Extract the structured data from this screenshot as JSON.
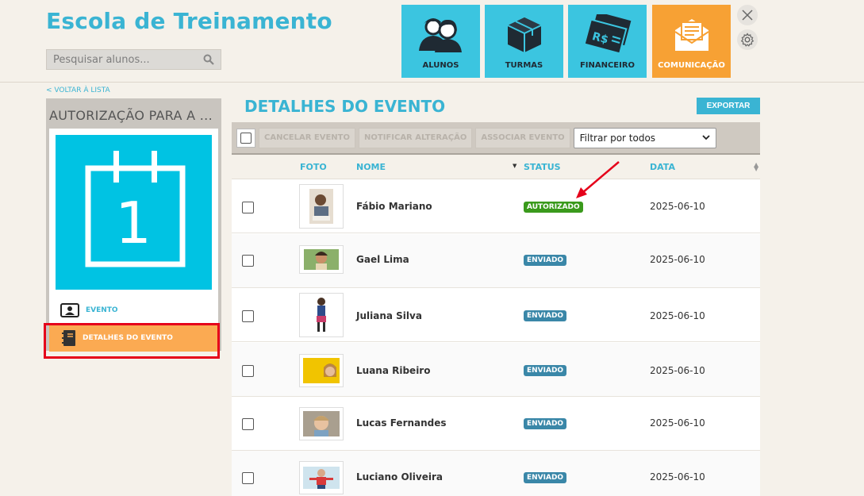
{
  "app": {
    "title": "Escola de Treinamento",
    "search_placeholder": "Pesquisar alunos..."
  },
  "nav": [
    {
      "label": "ALUNOS",
      "icon": "students-icon",
      "active": false
    },
    {
      "label": "TURMAS",
      "icon": "box-icon",
      "active": false
    },
    {
      "label": "FINANCEIRO",
      "icon": "money-icon",
      "active": false
    },
    {
      "label": "COMUNICAÇÃO",
      "icon": "envelope-icon",
      "active": true
    }
  ],
  "sidebar": {
    "back_link": "< VOLTAR À LISTA",
    "title": "AUTORIZAÇÃO PARA A ...",
    "calendar_day": "1",
    "items": [
      {
        "label": "EVENTO",
        "icon": "contact-card-icon"
      },
      {
        "label": "DETALHES DO EVENTO",
        "icon": "notebook-icon"
      }
    ]
  },
  "main": {
    "title": "DETALHES DO EVENTO",
    "export_label": "EXPORTAR",
    "toolbar": {
      "cancel": "CANCELAR EVENTO",
      "notify": "NOTIFICAR ALTERAÇÃO",
      "associate": "ASSOCIAR EVENTO",
      "filter": "Filtrar por todos"
    },
    "columns": {
      "photo": "FOTO",
      "name": "NOME",
      "status": "STATUS",
      "date": "DATA"
    },
    "rows": [
      {
        "name": "Fábio Mariano",
        "status": "AUTORIZADO",
        "date": "2025-06-10"
      },
      {
        "name": "Gael Lima",
        "status": "ENVIADO",
        "date": "2025-06-10"
      },
      {
        "name": "Juliana Silva",
        "status": "ENVIADO",
        "date": "2025-06-10"
      },
      {
        "name": "Luana Ribeiro",
        "status": "ENVIADO",
        "date": "2025-06-10"
      },
      {
        "name": "Lucas Fernandes",
        "status": "ENVIADO",
        "date": "2025-06-10"
      },
      {
        "name": "Luciano Oliveira",
        "status": "ENVIADO",
        "date": "2025-06-10"
      }
    ]
  },
  "colors": {
    "accent": "#3ab4d3",
    "tile": "#3bc5e0",
    "tile_active": "#f7a134",
    "status_autorizado": "#3a9a1c",
    "status_enviado": "#3a87a8",
    "highlight": "#e5001a"
  }
}
